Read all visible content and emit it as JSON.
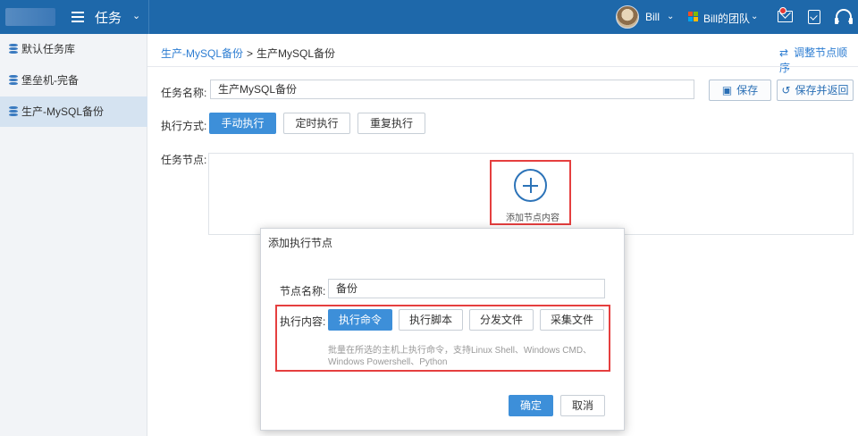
{
  "topbar": {
    "app_title": "任务",
    "user_name": "Bill",
    "team_name": "Bill的团队"
  },
  "sidebar": {
    "items": [
      {
        "label": "默认任务库"
      },
      {
        "label": "堡垒机-完备"
      },
      {
        "label": "生产-MySQL备份"
      }
    ]
  },
  "breadcrumb": {
    "parent": "生产-MySQL备份",
    "separator": ">",
    "current": "生产MySQL备份"
  },
  "reorder_label": "调整节点顺序",
  "form": {
    "task_name_label": "任务名称:",
    "task_name_value": "生产MySQL备份",
    "save_label": "保存",
    "save_return_label": "保存并返回",
    "exec_mode_label": "执行方式:",
    "exec_modes": [
      "手动执行",
      "定时执行",
      "重复执行"
    ],
    "task_node_label": "任务节点:",
    "add_node_label": "添加节点内容"
  },
  "modal": {
    "title": "添加执行节点",
    "node_name_label": "节点名称:",
    "node_name_value": "备份",
    "exec_content_label": "执行内容:",
    "content_types": [
      "执行命令",
      "执行脚本",
      "分发文件",
      "采集文件"
    ],
    "description": "批量在所选的主机上执行命令，支持Linux Shell、Windows CMD、Windows Powershell、Python",
    "confirm_label": "确定",
    "cancel_label": "取消"
  },
  "colors": {
    "topbar": "#1e68aa",
    "primary": "#3d8fd9",
    "highlight_red": "#e53f3f",
    "link": "#2d7dd2"
  }
}
